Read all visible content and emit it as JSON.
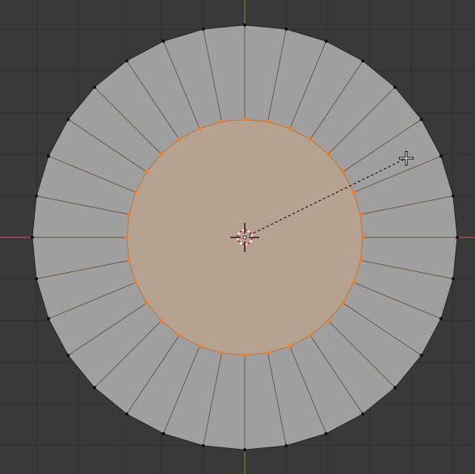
{
  "viewport": {
    "background_color": "#393939",
    "grid_color": "#2f2f2f",
    "x_axis_color": "#b5485a",
    "y_axis_color": "#6f8f2a"
  },
  "mesh": {
    "outer_ring_vertex_count": 32,
    "inner_ring_vertex_count": 32,
    "outer_face_color": "#9f9f9f",
    "outer_edge_color": "#1c1c1c",
    "selected_face_color": "#b5a290",
    "selected_edge_color": "#c8742a",
    "selected_vertex_color": "#ff7a1a",
    "unselected_vertex_color": "#111111"
  },
  "cursor": {
    "type": "3d-cursor",
    "icon": "crosshair-icon"
  },
  "pivot": {
    "icon": "pivot-point-icon"
  },
  "transform_line": {
    "style": "dashed",
    "color": "#000000"
  },
  "mouse_cursor": {
    "icon": "mouse-crosshair-icon"
  }
}
